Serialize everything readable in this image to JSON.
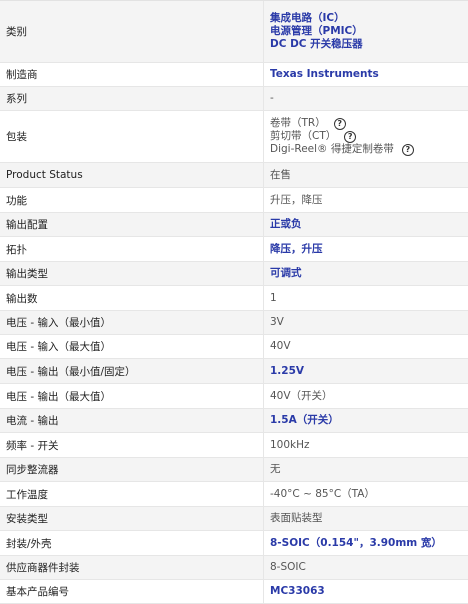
{
  "rows": [
    {
      "label": "类别",
      "values": [
        "集成电路（IC）",
        "电源管理（PMIC）",
        "DC DC 开关稳压器"
      ],
      "link": true,
      "h": 62
    },
    {
      "label": "制造商",
      "values": [
        "Texas Instruments"
      ],
      "link": true,
      "h": 24
    },
    {
      "label": "系列",
      "values": [
        "-"
      ],
      "link": false,
      "h": 24
    },
    {
      "label": "包装",
      "values": [
        "卷带（TR）",
        "剪切带（CT）",
        "Digi-Reel® 得捷定制卷带"
      ],
      "help": [
        true,
        true,
        true
      ],
      "link": false,
      "h": 52
    },
    {
      "label": "Product Status",
      "values": [
        "在售"
      ],
      "link": false,
      "h": 25
    },
    {
      "label": "功能",
      "values": [
        "升压，降压"
      ],
      "link": false,
      "h": 25
    },
    {
      "label": "输出配置",
      "values": [
        "正或负"
      ],
      "link": true,
      "h": 24
    },
    {
      "label": "拓扑",
      "values": [
        "降压，升压"
      ],
      "link": true,
      "h": 25
    },
    {
      "label": "输出类型",
      "values": [
        "可调式"
      ],
      "link": true,
      "h": 24
    },
    {
      "label": "输出数",
      "values": [
        "1"
      ],
      "link": false,
      "h": 25
    },
    {
      "label": "电压 - 输入（最小值）",
      "values": [
        "3V"
      ],
      "link": false,
      "h": 24
    },
    {
      "label": "电压 - 输入（最大值）",
      "values": [
        "40V"
      ],
      "link": false,
      "h": 24
    },
    {
      "label": "电压 - 输出（最小值/固定）",
      "values": [
        "1.25V"
      ],
      "link": true,
      "h": 25
    },
    {
      "label": "电压 - 输出（最大值）",
      "values": [
        "40V（开关）"
      ],
      "link": false,
      "h": 25
    },
    {
      "label": "电流 - 输出",
      "values": [
        "1.5A（开关）"
      ],
      "link": true,
      "h": 24
    },
    {
      "label": "频率 - 开关",
      "values": [
        "100kHz"
      ],
      "link": false,
      "h": 25
    },
    {
      "label": "同步整流器",
      "values": [
        "无"
      ],
      "link": false,
      "h": 24
    },
    {
      "label": "工作温度",
      "values": [
        "-40°C ~ 85°C（TA）"
      ],
      "link": false,
      "h": 25
    },
    {
      "label": "安装类型",
      "values": [
        "表面贴装型"
      ],
      "link": false,
      "h": 24
    },
    {
      "label": "封装/外壳",
      "values": [
        "8-SOIC（0.154\"，3.90mm 宽）"
      ],
      "link": true,
      "h": 25
    },
    {
      "label": "供应商器件封装",
      "values": [
        "8-SOIC"
      ],
      "link": false,
      "h": 24
    },
    {
      "label": "基本产品编号",
      "values": [
        "MC33063"
      ],
      "link": true,
      "h": 24
    }
  ]
}
